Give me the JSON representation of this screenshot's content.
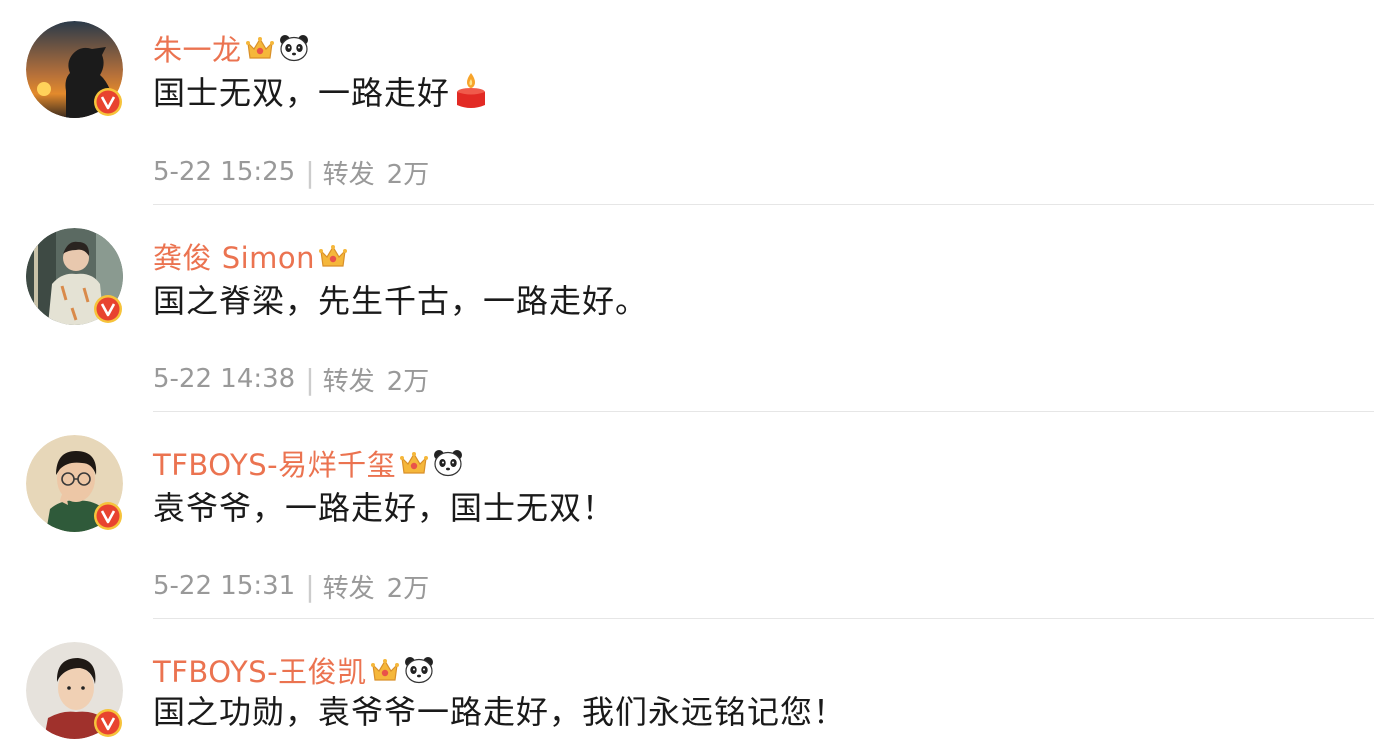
{
  "comments": [
    {
      "name": "朱一龙",
      "badges": [
        "crown-icon",
        "panda-icon"
      ],
      "content": "国士无双，一路走好",
      "content_icon": "candle-icon",
      "time": "5-22 15:25",
      "separator": "|",
      "repost_label": "转发",
      "repost_count": "2万"
    },
    {
      "name": "龚俊 Simon",
      "badges": [
        "crown-icon"
      ],
      "content": "国之脊梁，先生千古，一路走好。",
      "time": "5-22 14:38",
      "separator": "|",
      "repost_label": "转发",
      "repost_count": "2万"
    },
    {
      "name": "TFBOYS-易烊千玺",
      "badges": [
        "crown-icon",
        "panda-icon"
      ],
      "content": "袁爷爷，一路走好，国士无双！",
      "time": "5-22 15:31",
      "separator": "|",
      "repost_label": "转发",
      "repost_count": "2万"
    },
    {
      "name": "TFBOYS-王俊凯",
      "badges": [
        "crown-icon",
        "panda-icon"
      ],
      "content": "国之功勋，袁爷爷一路走好，我们永远铭记您！"
    }
  ],
  "colors": {
    "name": "#eb7350",
    "content": "#1a1a1a",
    "meta": "#999999",
    "verified_badge": "#e8432f",
    "verified_badge_ring": "#f6c33b"
  }
}
